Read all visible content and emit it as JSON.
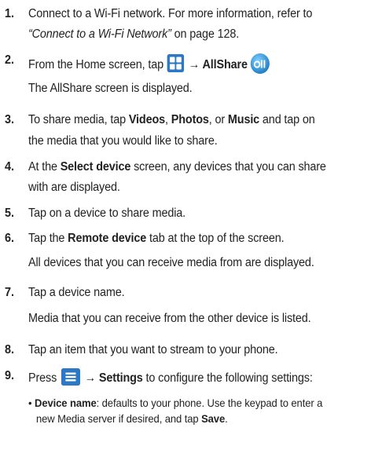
{
  "steps": [
    {
      "number": "1.",
      "line1": "Connect to a Wi-Fi network. For more information, refer to",
      "ref_title": "“Connect to a Wi-Fi Network”",
      "ref_page": " on page 128."
    },
    {
      "number": "2.",
      "pre": "From the Home screen, tap ",
      "arrow": " → ",
      "app_name": "AllShare",
      "note": "The AllShare screen is displayed."
    },
    {
      "number": "3.",
      "pre": "To share media, tap ",
      "videos": "Videos",
      "sep1": ", ",
      "photos": "Photos",
      "sep2": ", or ",
      "music": "Music",
      "post": " and tap on",
      "line2": "the media that you would like to share."
    },
    {
      "number": "4.",
      "pre": "At the ",
      "select_device": "Select device",
      "post": " screen, any devices that you can share",
      "line2": "with are displayed."
    },
    {
      "number": "5.",
      "text": "Tap on a device to share media."
    },
    {
      "number": "6.",
      "pre": "Tap the ",
      "remote_device": "Remote device",
      "post": " tab at the top of the screen.",
      "note": "All devices that you can receive media from are displayed."
    },
    {
      "number": "7.",
      "text": "Tap a device name.",
      "note": "Media that you can receive from the other device is listed."
    },
    {
      "number": "8.",
      "text": "Tap an item that you want to stream to your phone."
    },
    {
      "number": "9.",
      "pre": "Press ",
      "arrow": " → ",
      "settings": "Settings",
      "post": " to configure the following settings:"
    }
  ],
  "bullets": [
    {
      "bullet": "•",
      "term": "Device name",
      "text1": ": defaults to your phone. Use the keypad to enter a",
      "text2_pre": "new Media server if desired, and tap ",
      "save": "Save",
      "text2_post": "."
    }
  ]
}
